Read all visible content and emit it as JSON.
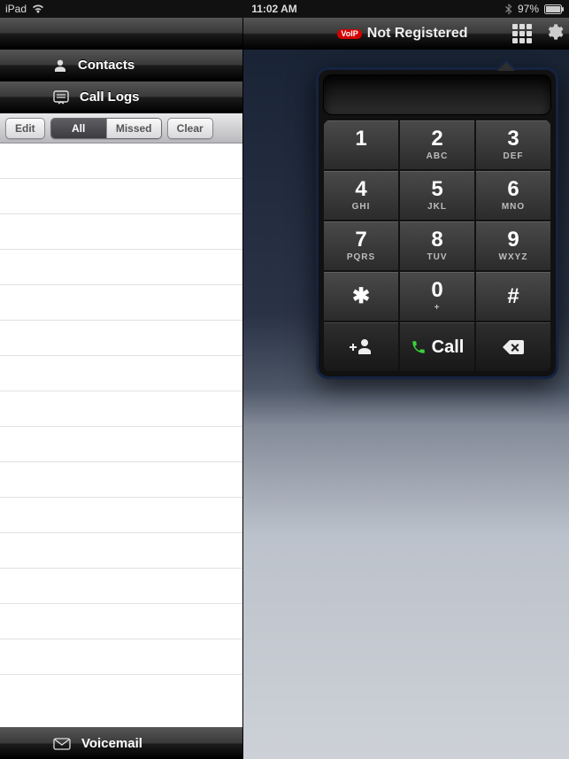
{
  "status_bar": {
    "carrier": "iPad",
    "time": "11:02 AM",
    "battery": "97%"
  },
  "left_panel": {
    "contacts": {
      "label": "Contacts"
    },
    "call_logs": {
      "label": "Call Logs"
    },
    "filter": {
      "edit": "Edit",
      "all": "All",
      "missed": "Missed",
      "clear": "Clear"
    },
    "voicemail": {
      "label": "Voicemail"
    }
  },
  "right_panel": {
    "voip_badge": "VoIP",
    "status": "Not Registered"
  },
  "dialpad": {
    "keys": [
      {
        "digit": "1",
        "sub": ""
      },
      {
        "digit": "2",
        "sub": "ABC"
      },
      {
        "digit": "3",
        "sub": "DEF"
      },
      {
        "digit": "4",
        "sub": "GHI"
      },
      {
        "digit": "5",
        "sub": "JKL"
      },
      {
        "digit": "6",
        "sub": "MNO"
      },
      {
        "digit": "7",
        "sub": "PQRS"
      },
      {
        "digit": "8",
        "sub": "TUV"
      },
      {
        "digit": "9",
        "sub": "WXYZ"
      },
      {
        "digit": "✱",
        "sub": ""
      },
      {
        "digit": "0",
        "sub": "+"
      },
      {
        "digit": "#",
        "sub": ""
      }
    ],
    "call_label": "Call"
  }
}
